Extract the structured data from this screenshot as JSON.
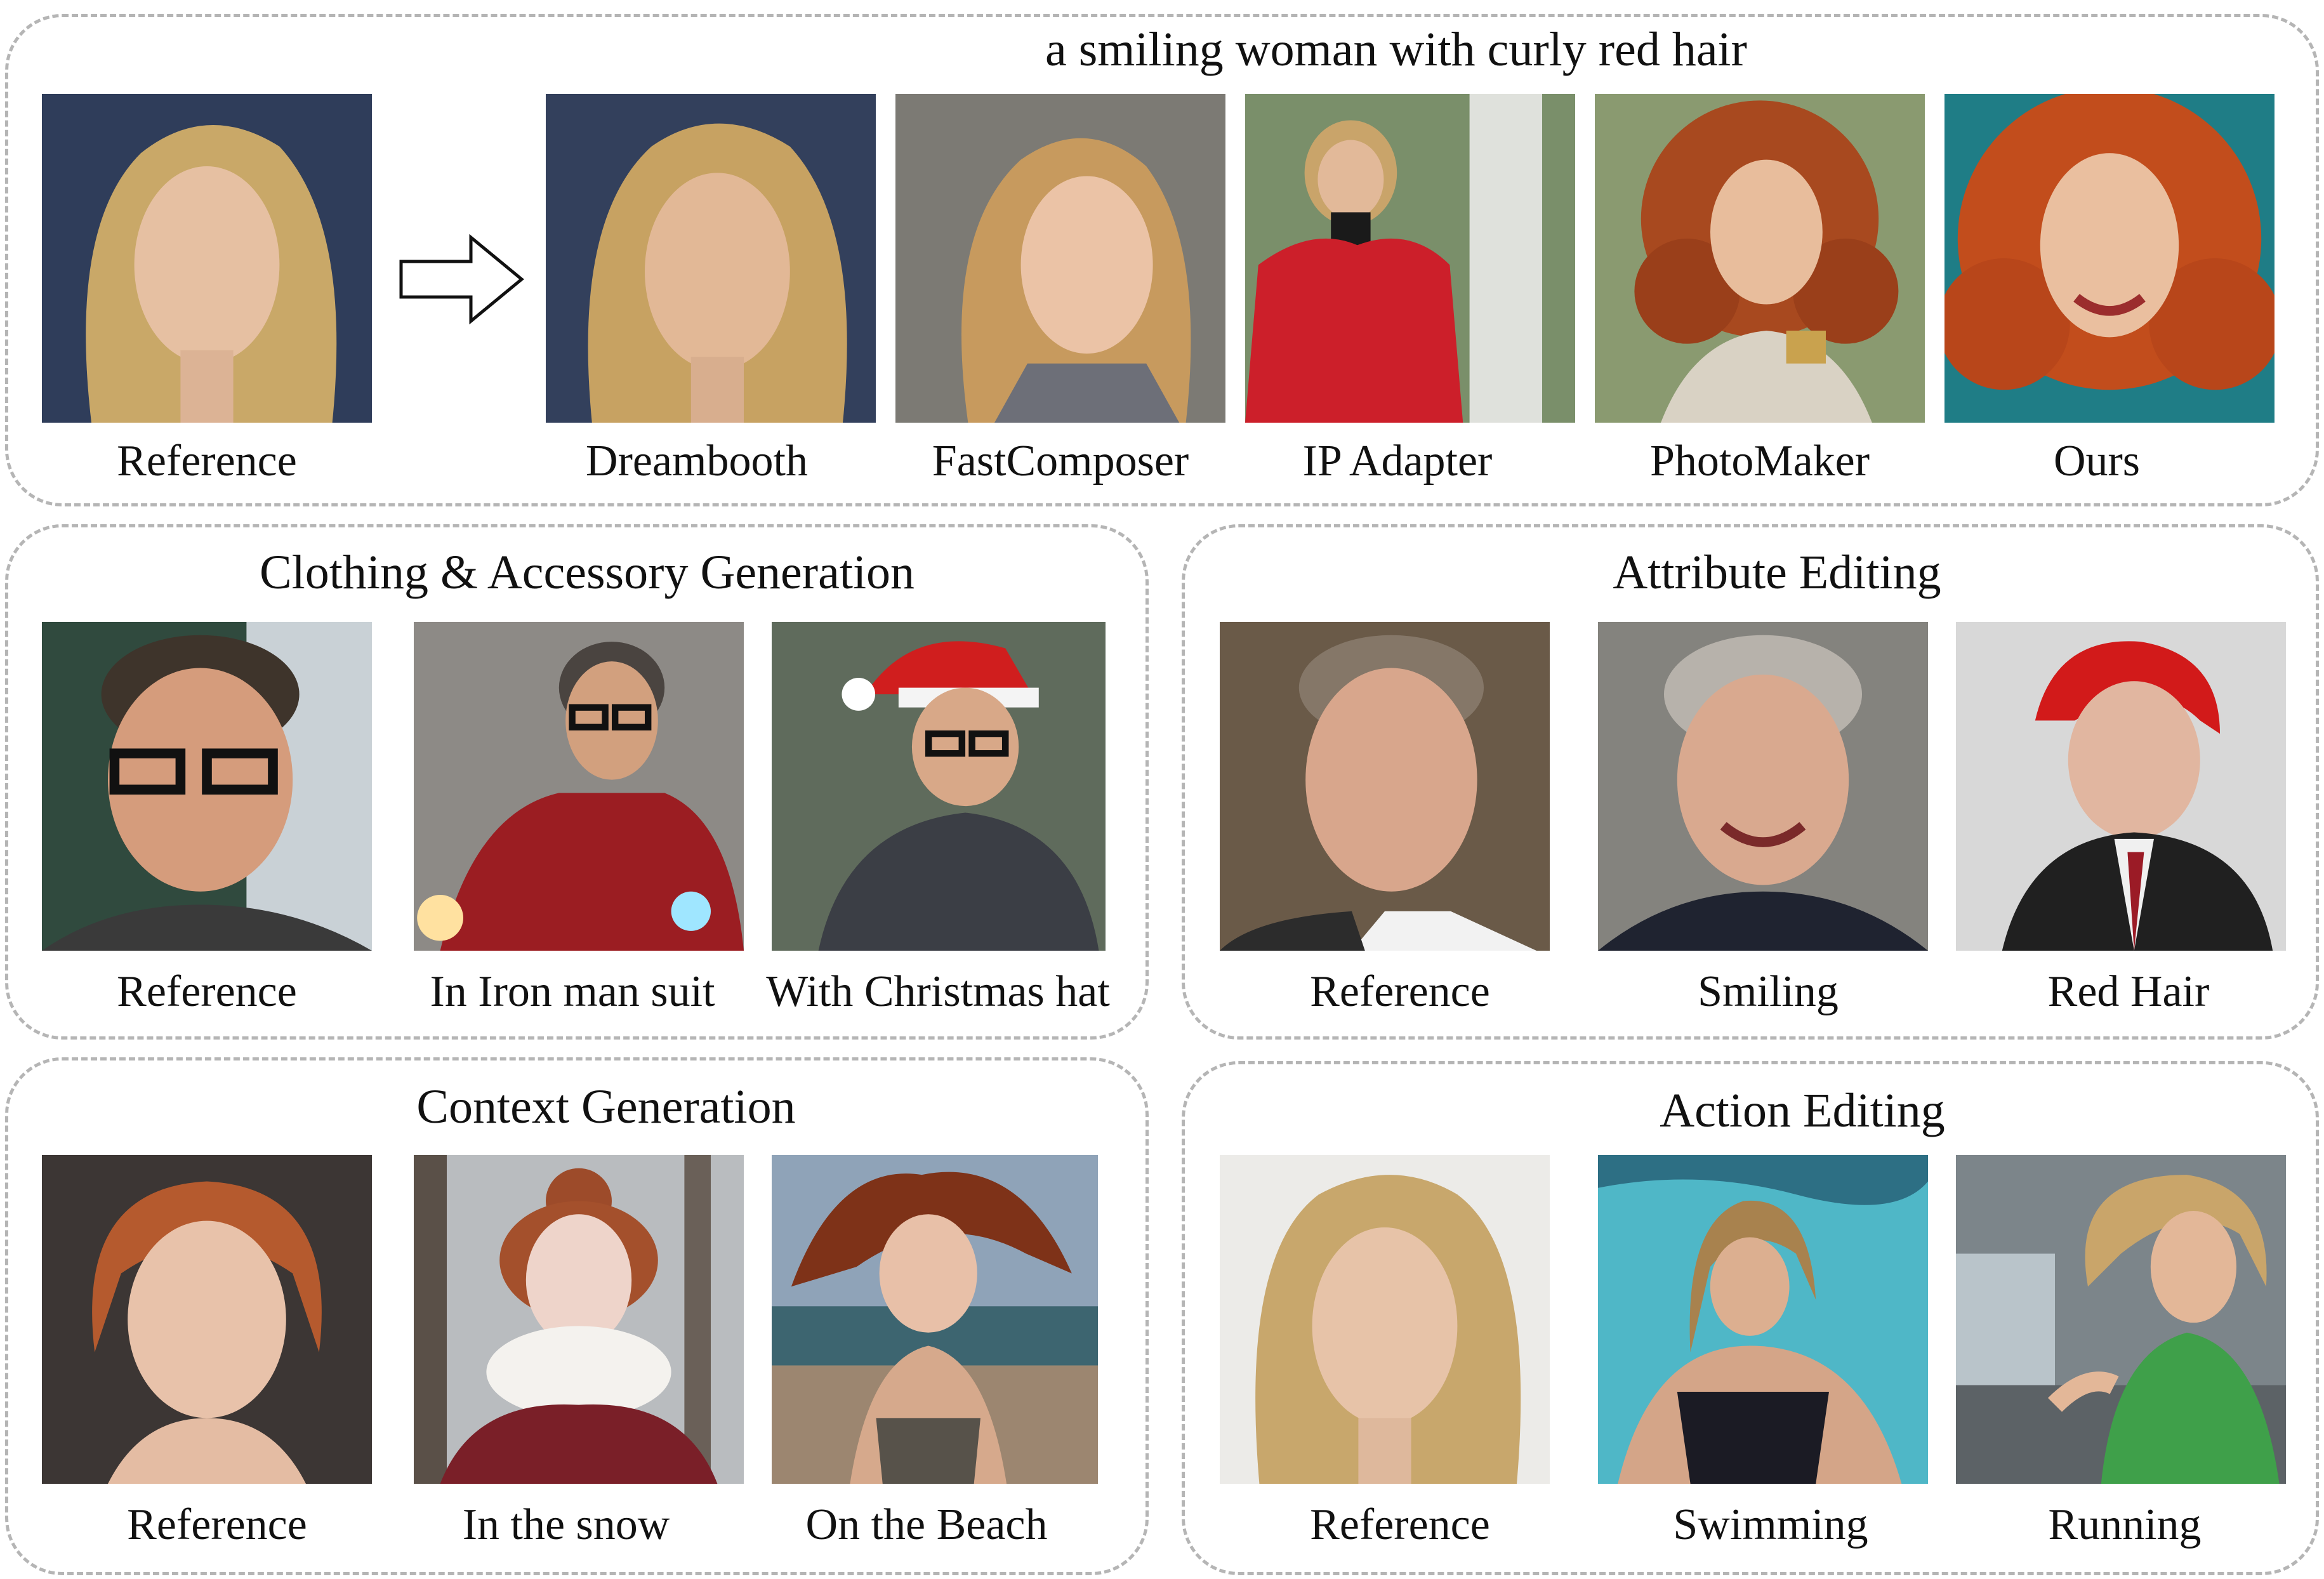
{
  "top": {
    "prompt": "a smiling woman with curly red hair",
    "captions": [
      "Reference",
      "Dreambooth",
      "FastComposer",
      "IP Adapter",
      "PhotoMaker",
      "Ours"
    ]
  },
  "clothing": {
    "title": "Clothing & Accessory Generation",
    "captions": [
      "Reference",
      "In Iron man suit",
      "With Christmas hat"
    ]
  },
  "attribute": {
    "title": "Attribute Editing",
    "captions": [
      "Reference",
      "Smiling",
      "Red Hair"
    ]
  },
  "context": {
    "title": "Context Generation",
    "captions": [
      "Reference",
      "In the snow",
      "On the Beach"
    ]
  },
  "action": {
    "title": "Action Editing",
    "captions": [
      "Reference",
      "Swimming",
      "Running"
    ]
  },
  "colors": {
    "panel_border": "#b5b5b5",
    "blonde_hair": "#c9a868",
    "red_hair": "#b5471f",
    "skin": "#e6bfa0"
  }
}
